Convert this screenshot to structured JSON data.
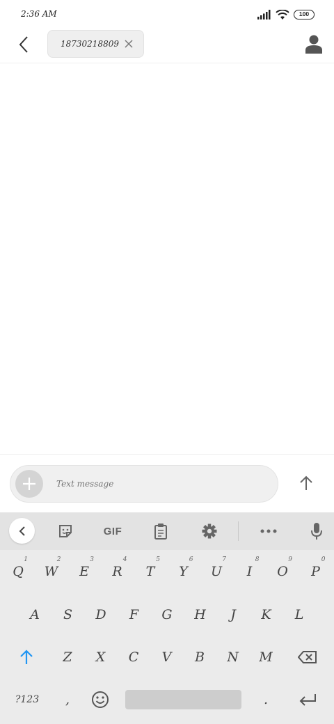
{
  "status_bar": {
    "time": "2:36 AM",
    "battery": "100"
  },
  "header": {
    "recipient": "18730218809"
  },
  "compose": {
    "placeholder": "Text message"
  },
  "keyboard": {
    "toolbar": {
      "gif_label": "GIF"
    },
    "row1": [
      {
        "label": "Q",
        "hint": "1"
      },
      {
        "label": "W",
        "hint": "2"
      },
      {
        "label": "E",
        "hint": "3"
      },
      {
        "label": "R",
        "hint": "4"
      },
      {
        "label": "T",
        "hint": "5"
      },
      {
        "label": "Y",
        "hint": "6"
      },
      {
        "label": "U",
        "hint": "7"
      },
      {
        "label": "I",
        "hint": "8"
      },
      {
        "label": "O",
        "hint": "9"
      },
      {
        "label": "P",
        "hint": "0"
      }
    ],
    "row2": [
      "A",
      "S",
      "D",
      "F",
      "G",
      "H",
      "J",
      "K",
      "L"
    ],
    "row3": [
      "Z",
      "X",
      "C",
      "V",
      "B",
      "N",
      "M"
    ],
    "row4": {
      "symbols": "?123",
      "comma": ",",
      "period": "."
    }
  },
  "colors": {
    "accent": "#2196f3",
    "keyboard_bg": "#ebebeb",
    "toolbar_bg": "#e3e3e3"
  }
}
